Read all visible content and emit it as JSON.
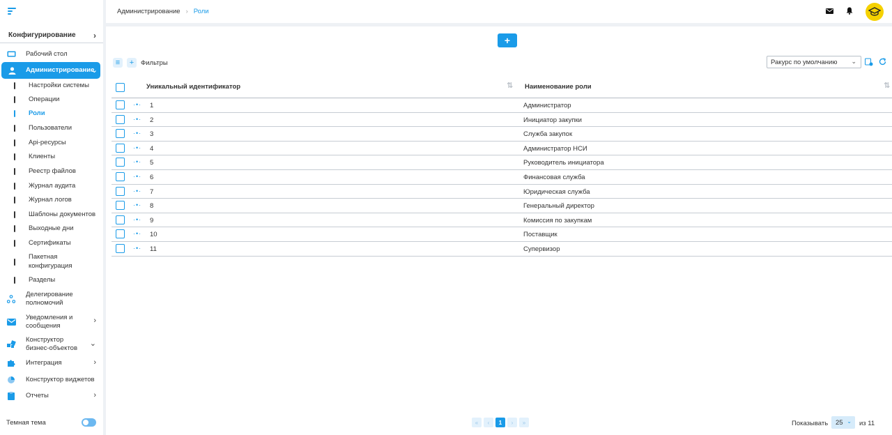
{
  "sidebar": {
    "section_title": "Конфигурирование",
    "items": [
      {
        "label": "Рабочий стол"
      },
      {
        "label": "Администрирование"
      },
      {
        "label": "Делегирование полномочий"
      },
      {
        "label": "Уведомления и сообщения"
      },
      {
        "label": "Конструктор бизнес-объектов"
      },
      {
        "label": "Интеграция"
      },
      {
        "label": "Конструктор виджетов"
      },
      {
        "label": "Отчеты"
      }
    ],
    "subitems": [
      "Настройки системы",
      "Операции",
      "Роли",
      "Пользователи",
      "Api-ресурсы",
      "Клиенты",
      "Реестр файлов",
      "Журнал аудита",
      "Журнал логов",
      "Шаблоны документов",
      "Выходные дни",
      "Сертификаты",
      "Пакетная конфигурация",
      "Разделы"
    ],
    "theme_label": "Темная тема"
  },
  "breadcrumb": {
    "parent": "Администрирование",
    "separator": "›",
    "current": "Роли"
  },
  "toolbar": {
    "add_label": "+",
    "filters_label": "Фильтры",
    "view_select": "Ракурс по умолчанию"
  },
  "table": {
    "columns": [
      "Уникальный идентификатор",
      "Наименование роли"
    ],
    "rows": [
      {
        "id": "1",
        "name": "Администратор"
      },
      {
        "id": "2",
        "name": "Инициатор закупки"
      },
      {
        "id": "3",
        "name": "Служба закупок"
      },
      {
        "id": "4",
        "name": "Администратор НСИ"
      },
      {
        "id": "5",
        "name": "Руководитель инициатора"
      },
      {
        "id": "6",
        "name": "Финансовая служба"
      },
      {
        "id": "7",
        "name": "Юридическая служба"
      },
      {
        "id": "8",
        "name": "Генеральный директор"
      },
      {
        "id": "9",
        "name": "Комиссия по закупкам"
      },
      {
        "id": "10",
        "name": "Поставщик"
      },
      {
        "id": "11",
        "name": "Супервизор"
      }
    ]
  },
  "pagination": {
    "first": "«",
    "prev": "‹",
    "current_page": "1",
    "next": "›",
    "last": "»",
    "show_label": "Показывать",
    "per_page": "25",
    "total": "из 11"
  },
  "colors": {
    "accent": "#1a9be8",
    "background": "#eef1f5",
    "avatar": "#f5d100"
  }
}
